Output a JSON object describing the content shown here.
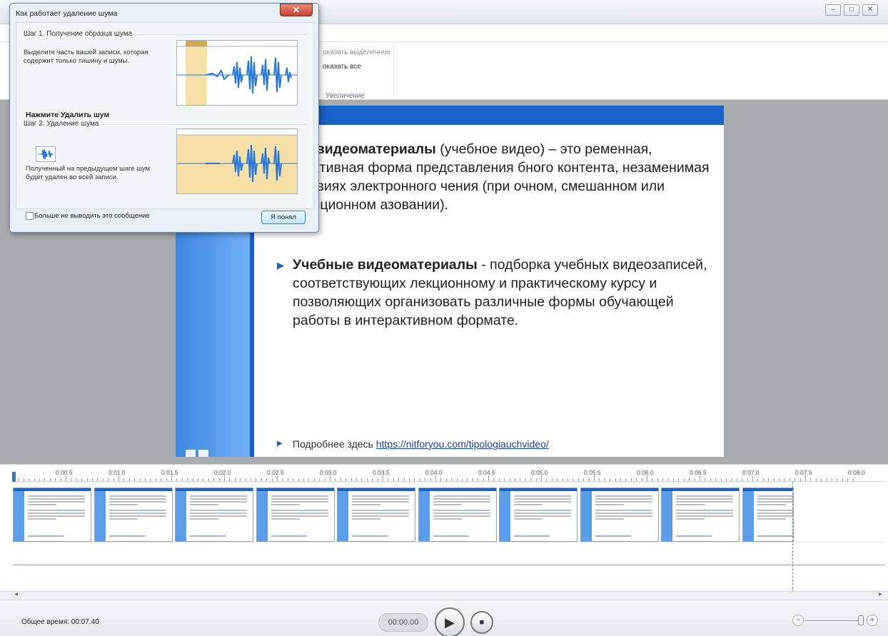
{
  "window": {
    "controls": [
      "–",
      "□",
      "✕"
    ]
  },
  "ribbon": {
    "show_selected": "оказать выделенное",
    "show_all": "оказать все",
    "group_label": "Увеличение"
  },
  "slide": {
    "para1_bold": "бные видеоматериалы",
    "para1_rest": " (учебное видео) – это ременная, эффективная форма представления бного контента, незаменимая в условиях электронного чения (при очном, смешанном или дистанционном азовании).",
    "para2_bold": "Учебные видеоматериалы",
    "para2_rest": " - подборка учебных видеозаписей, соответствующих лекционному и практическому курсу и позволяющих организовать различные формы обучающей работы в интерактивном формате.",
    "more_prefix": "Подробнее здесь ",
    "more_link": "https://nitforyou.com/tipologiauchvideo/"
  },
  "dialog": {
    "title": "Как работает удаление шума",
    "close": "✕",
    "step1_header": "Шаг 1. Получение образца шума",
    "step1_text": "Выделите часть вашей записи, которая содержит только тишину и шумы.",
    "step2_header": "Шаг 2. Удаление шума",
    "step2_bold": "Нажмите Удалить шум",
    "step2_text": "Полученный на предыдущем шаге шум будет удален во всей записи.",
    "checkbox_label": "Больше не выводить это сообщение",
    "ok_button": "Я понял"
  },
  "timeline": {
    "ticks": [
      "0:00.5",
      "0:01.0",
      "0:01.5",
      "0:02.0",
      "0:02.5",
      "0:03.0",
      "0:03.5",
      "0:04.0",
      "0:04.5",
      "0:05.0",
      "0:05.5",
      "0:06.0",
      "0:06.5",
      "0:07.0",
      "0:07.5",
      "0:08.0"
    ],
    "thumbnail_count": 10
  },
  "bottombar": {
    "total_time": "Общее время: 00:07.40",
    "current_time": "00:00.00",
    "play": "▶",
    "stop": "■",
    "zoom_minus": "−",
    "zoom_plus": "+"
  },
  "colors": {
    "accent_blue": "#1861c8",
    "workspace_gray": "#a9acaf",
    "selection_yellow": "#f7e0a8"
  }
}
